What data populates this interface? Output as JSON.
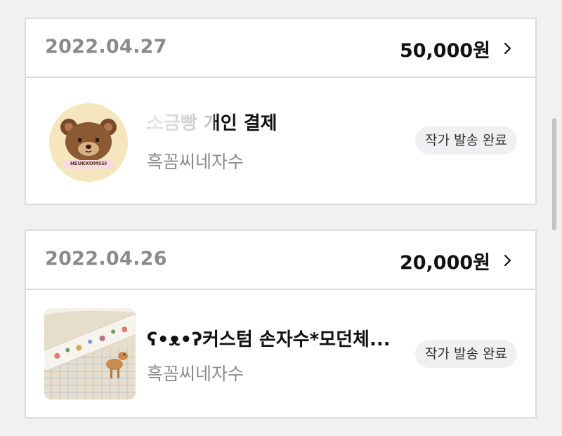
{
  "orders": [
    {
      "date": "2022.04.27",
      "amount": "50,000원",
      "item": {
        "title": "소금빵 개인 결제",
        "shop": "흑꼼씨네자수",
        "status": "작가 발송 완료",
        "thumbnail_text": "HEUKKOMSSI"
      }
    },
    {
      "date": "2022.04.26",
      "amount": "20,000원",
      "item": {
        "title": "ʕ•ᴥ•ʔ커스텀 손자수*모던체...",
        "shop": "흑꼼씨네자수",
        "status": "작가 발송 완료"
      }
    }
  ],
  "colors": {
    "background": "#f1f1f2",
    "card": "#ffffff",
    "border": "#dcdcde",
    "date_text": "#8a8a8c",
    "amount_text": "#111111",
    "badge_bg": "#f0f0f2"
  },
  "icons": {
    "chevron": "chevron-right-icon"
  }
}
